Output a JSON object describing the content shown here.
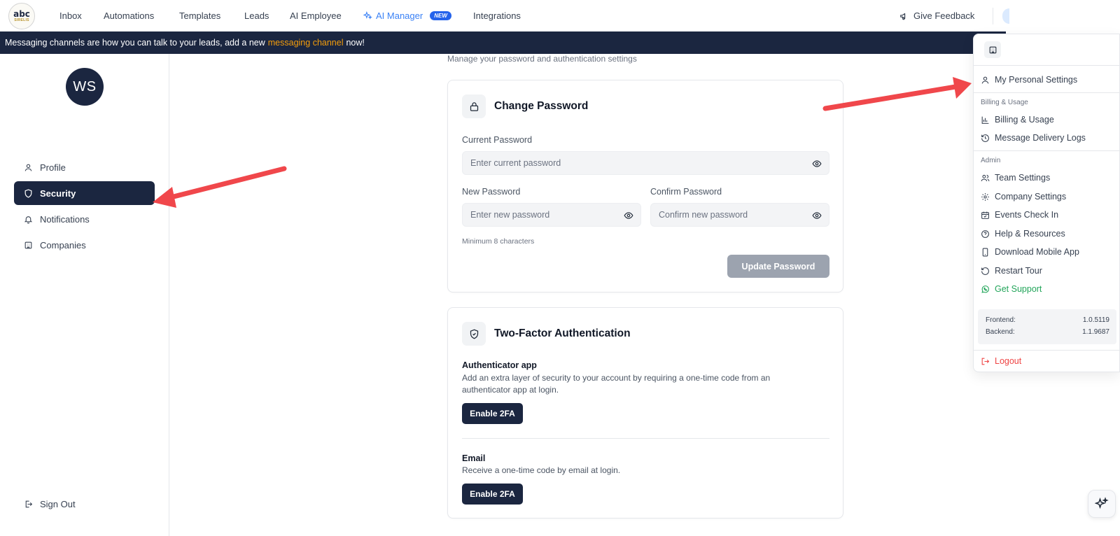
{
  "logo": {
    "line1": "abc",
    "line2": "SIRELIS"
  },
  "nav": {
    "items": [
      "Inbox",
      "Automations",
      "Templates",
      "Leads",
      "AI Employee",
      "AI Manager",
      "Integrations"
    ],
    "ai_manager_badge": "NEW",
    "feedback": "Give Feedback"
  },
  "banner": {
    "text_before": "Messaging channels are how you can talk to your leads, add a new",
    "link": "messaging channel",
    "text_after": "now!"
  },
  "sidebar": {
    "avatar_initials": "WS",
    "items": [
      {
        "label": "Profile",
        "icon": "user-icon"
      },
      {
        "label": "Security",
        "icon": "shield-icon",
        "active": true
      },
      {
        "label": "Notifications",
        "icon": "bell-icon"
      },
      {
        "label": "Companies",
        "icon": "building-icon"
      }
    ],
    "sign_out": "Sign Out"
  },
  "main": {
    "subtitle": "Manage your password and authentication settings",
    "change_password": {
      "title": "Change Password",
      "current_label": "Current Password",
      "current_placeholder": "Enter current password",
      "new_label": "New Password",
      "new_placeholder": "Enter new password",
      "confirm_label": "Confirm Password",
      "confirm_placeholder": "Confirm new password",
      "hint": "Minimum 8 characters",
      "update_button": "Update Password"
    },
    "two_factor": {
      "title": "Two-Factor Authentication",
      "app_title": "Authenticator app",
      "app_desc": "Add an extra layer of security to your account by requiring a one-time code from an authenticator app at login.",
      "app_button": "Enable 2FA",
      "email_title": "Email",
      "email_desc": "Receive a one-time code by email at login.",
      "email_button": "Enable 2FA"
    }
  },
  "menu": {
    "personal_settings": "My Personal Settings",
    "group_billing": "Billing & Usage",
    "billing_usage": "Billing & Usage",
    "delivery_logs": "Message Delivery Logs",
    "group_admin": "Admin",
    "team_settings": "Team Settings",
    "company_settings": "Company Settings",
    "events_check_in": "Events Check In",
    "help_resources": "Help & Resources",
    "download_app": "Download Mobile App",
    "restart_tour": "Restart Tour",
    "get_support": "Get Support",
    "frontend_label": "Frontend:",
    "frontend_version": "1.0.5119",
    "backend_label": "Backend:",
    "backend_version": "1.1.9687",
    "logout": "Logout"
  },
  "colors": {
    "navy": "#1b2640",
    "banner_link": "#f59e0b",
    "ai_blue": "#3b82f6",
    "support_green": "#22a55a",
    "logout_red": "#ef4444",
    "arrow_red": "#f0474b"
  }
}
